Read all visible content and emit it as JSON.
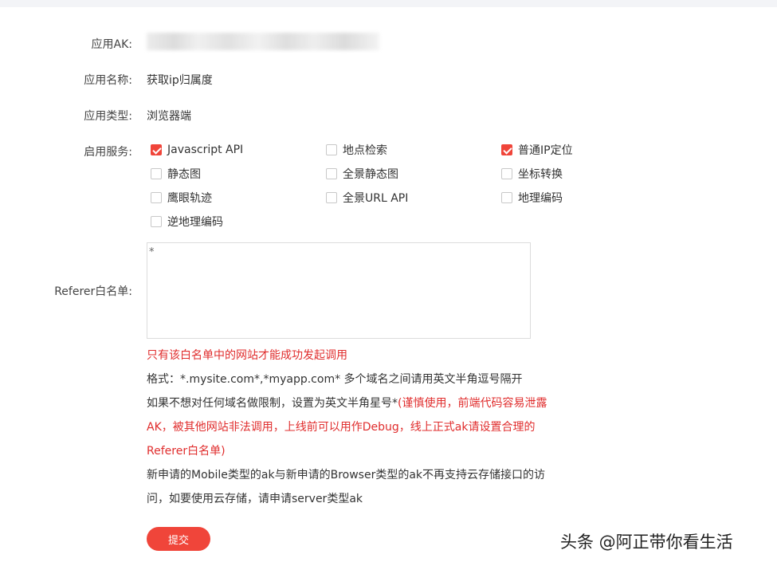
{
  "form": {
    "ak_label": "应用AK:",
    "name_label": "应用名称:",
    "name_value": "获取ip归属度",
    "type_label": "应用类型:",
    "type_value": "浏览器端",
    "services_label": "启用服务:",
    "services": [
      {
        "label": "Javascript API",
        "checked": true
      },
      {
        "label": "地点检索",
        "checked": false
      },
      {
        "label": "普通IP定位",
        "checked": true
      },
      {
        "label": "静态图",
        "checked": false
      },
      {
        "label": "全景静态图",
        "checked": false
      },
      {
        "label": "坐标转换",
        "checked": false
      },
      {
        "label": "鹰眼轨迹",
        "checked": false
      },
      {
        "label": "全景URL API",
        "checked": false
      },
      {
        "label": "地理编码",
        "checked": false
      },
      {
        "label": "逆地理编码",
        "checked": false
      }
    ],
    "referer_label": "Referer白名单:",
    "referer_value": "*",
    "notes": {
      "line1": "只有该白名单中的网站才能成功发起调用",
      "line2": "格式：*.mysite.com*,*myapp.com* 多个域名之间请用英文半角逗号隔开",
      "line3_plain": "如果不想对任何域名做限制，设置为英文半角星号*",
      "line3_red": "(谨慎使用，前端代码容易泄露AK，被其他网站非法调用，上线前可以用作Debug，线上正式ak请设置合理的Referer白名单)",
      "line4": "新申请的Mobile类型的ak与新申请的Browser类型的ak不再支持云存储接口的访问，如要使用云存储，请申请server类型ak"
    },
    "submit_label": "提交"
  },
  "watermark": "头条 @阿正带你看生活",
  "colors": {
    "accent": "#f0453a",
    "warning_text": "#e02d2d"
  }
}
